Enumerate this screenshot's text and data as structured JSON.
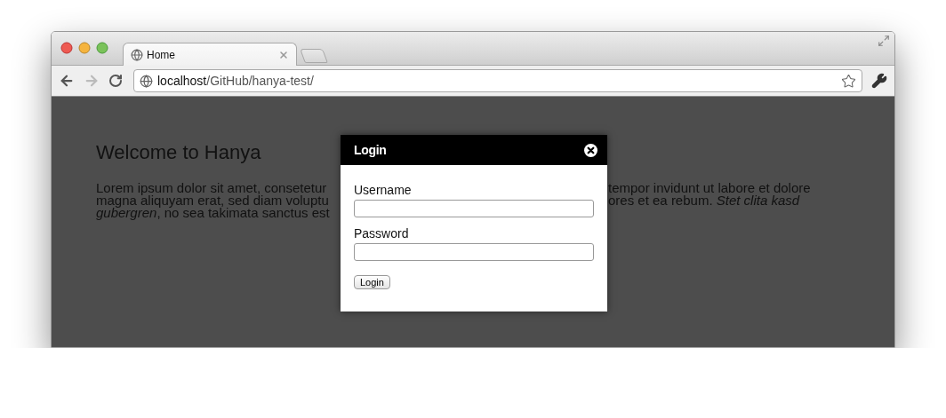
{
  "browser": {
    "tab_title": "Home",
    "address": "**localhost**/GitHub/hanya-test/",
    "forward_disabled": true
  },
  "page": {
    "heading": "Welcome to Hanya",
    "paragraph_lines": [
      {
        "left": "Lorem ipsum dolor sit amet, consetetur",
        "right": "tempor invidunt ut labore et dolore"
      },
      {
        "left": "magna aliquyam erat, sed diam voluptu",
        "right": "ores et ea rebum. *Stet clita kasd*"
      },
      {
        "left": "*gubergren*, no sea takimata sanctus est"
      }
    ]
  },
  "dialog": {
    "title": "Login",
    "fields": [
      {
        "label": "Username"
      },
      {
        "label": "Password"
      }
    ],
    "submit": "Login"
  }
}
